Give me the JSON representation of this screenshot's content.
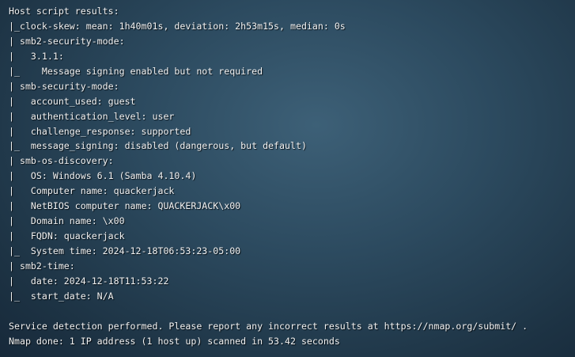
{
  "terminal": {
    "lines": [
      "Host script results:",
      "|_clock-skew: mean: 1h40m01s, deviation: 2h53m15s, median: 0s",
      "| smb2-security-mode:",
      "|   3.1.1:",
      "|_    Message signing enabled but not required",
      "| smb-security-mode:",
      "|   account_used: guest",
      "|   authentication_level: user",
      "|   challenge_response: supported",
      "|_  message_signing: disabled (dangerous, but default)",
      "| smb-os-discovery:",
      "|   OS: Windows 6.1 (Samba 4.10.4)",
      "|   Computer name: quackerjack",
      "|   NetBIOS computer name: QUACKERJACK\\x00",
      "|   Domain name: \\x00",
      "|   FQDN: quackerjack",
      "|_  System time: 2024-12-18T06:53:23-05:00",
      "| smb2-time:",
      "|   date: 2024-12-18T11:53:22",
      "|_  start_date: N/A",
      "",
      "Service detection performed. Please report any incorrect results at https://nmap.org/submit/ .",
      "Nmap done: 1 IP address (1 host up) scanned in 53.42 seconds"
    ]
  }
}
